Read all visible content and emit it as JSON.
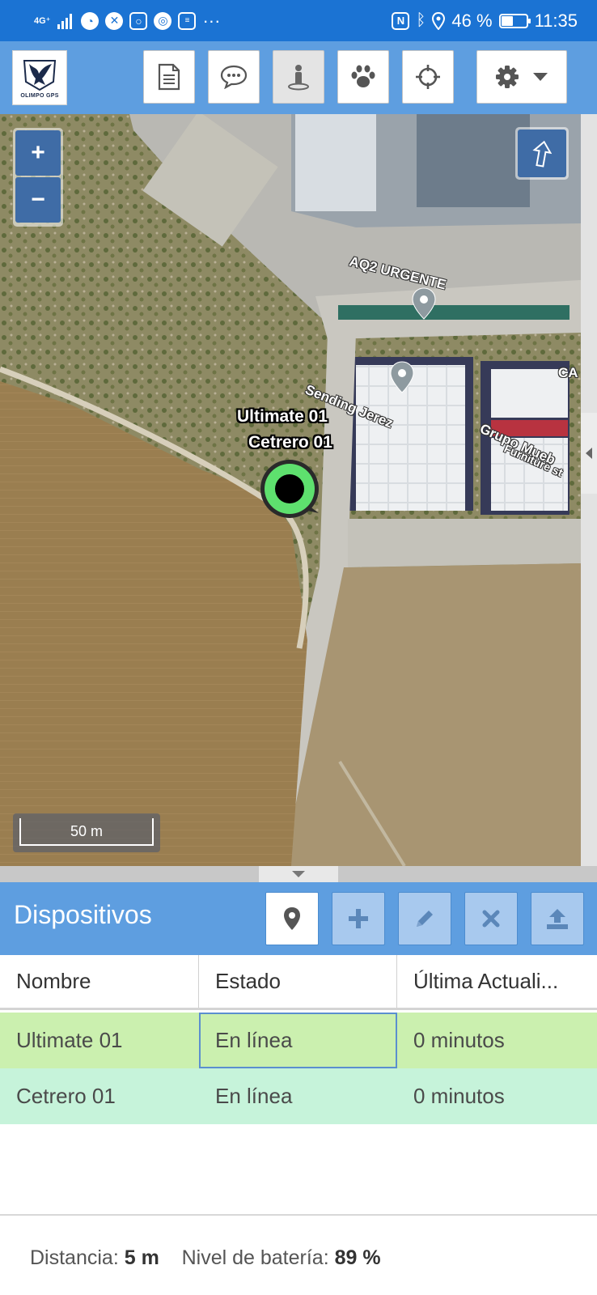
{
  "status_bar": {
    "network": "4G⁺",
    "more": "···",
    "battery_text": "46 %",
    "battery_level": 0.46,
    "time": "11:35"
  },
  "toolbar": {
    "logo_text": "OLIMPO GPS",
    "buttons": [
      {
        "name": "report-button",
        "icon": "document-icon"
      },
      {
        "name": "chat-button",
        "icon": "speech-bubble-icon"
      },
      {
        "name": "person-button",
        "icon": "person-pin-icon",
        "active": true
      },
      {
        "name": "paw-button",
        "icon": "paw-icon"
      },
      {
        "name": "locate-button",
        "icon": "crosshair-icon"
      },
      {
        "name": "settings-button",
        "icon": "gear-icon"
      }
    ]
  },
  "map": {
    "zoom_in": "+",
    "zoom_out": "−",
    "scale_label": "50 m",
    "device_labels": [
      "Ultimate 01",
      "Cetrero 01"
    ],
    "poi_labels": [
      "AQ2 URGENTE",
      "Sending Jerez",
      "Grupo Mueb",
      "Furniture st",
      "CA"
    ]
  },
  "devices_panel": {
    "title": "Dispositivos",
    "columns": [
      "Nombre",
      "Estado",
      "Última Actuali..."
    ],
    "rows": [
      {
        "nombre": "Ultimate 01",
        "estado": "En línea",
        "ultima": "0 minutos"
      },
      {
        "nombre": "Cetrero 01",
        "estado": "En línea",
        "ultima": "0 minutos"
      }
    ]
  },
  "footer": {
    "distance_label": "Distancia:",
    "distance_value": "5 m",
    "battery_label": "Nivel de batería:",
    "battery_value": "89 %"
  },
  "colors": {
    "status_bar": "#1b73d3",
    "toolbar": "#5e9ee0",
    "row_online_1": "#cbf0af",
    "row_online_2": "#c6f3da",
    "marker_ring": "#5ee06e"
  }
}
